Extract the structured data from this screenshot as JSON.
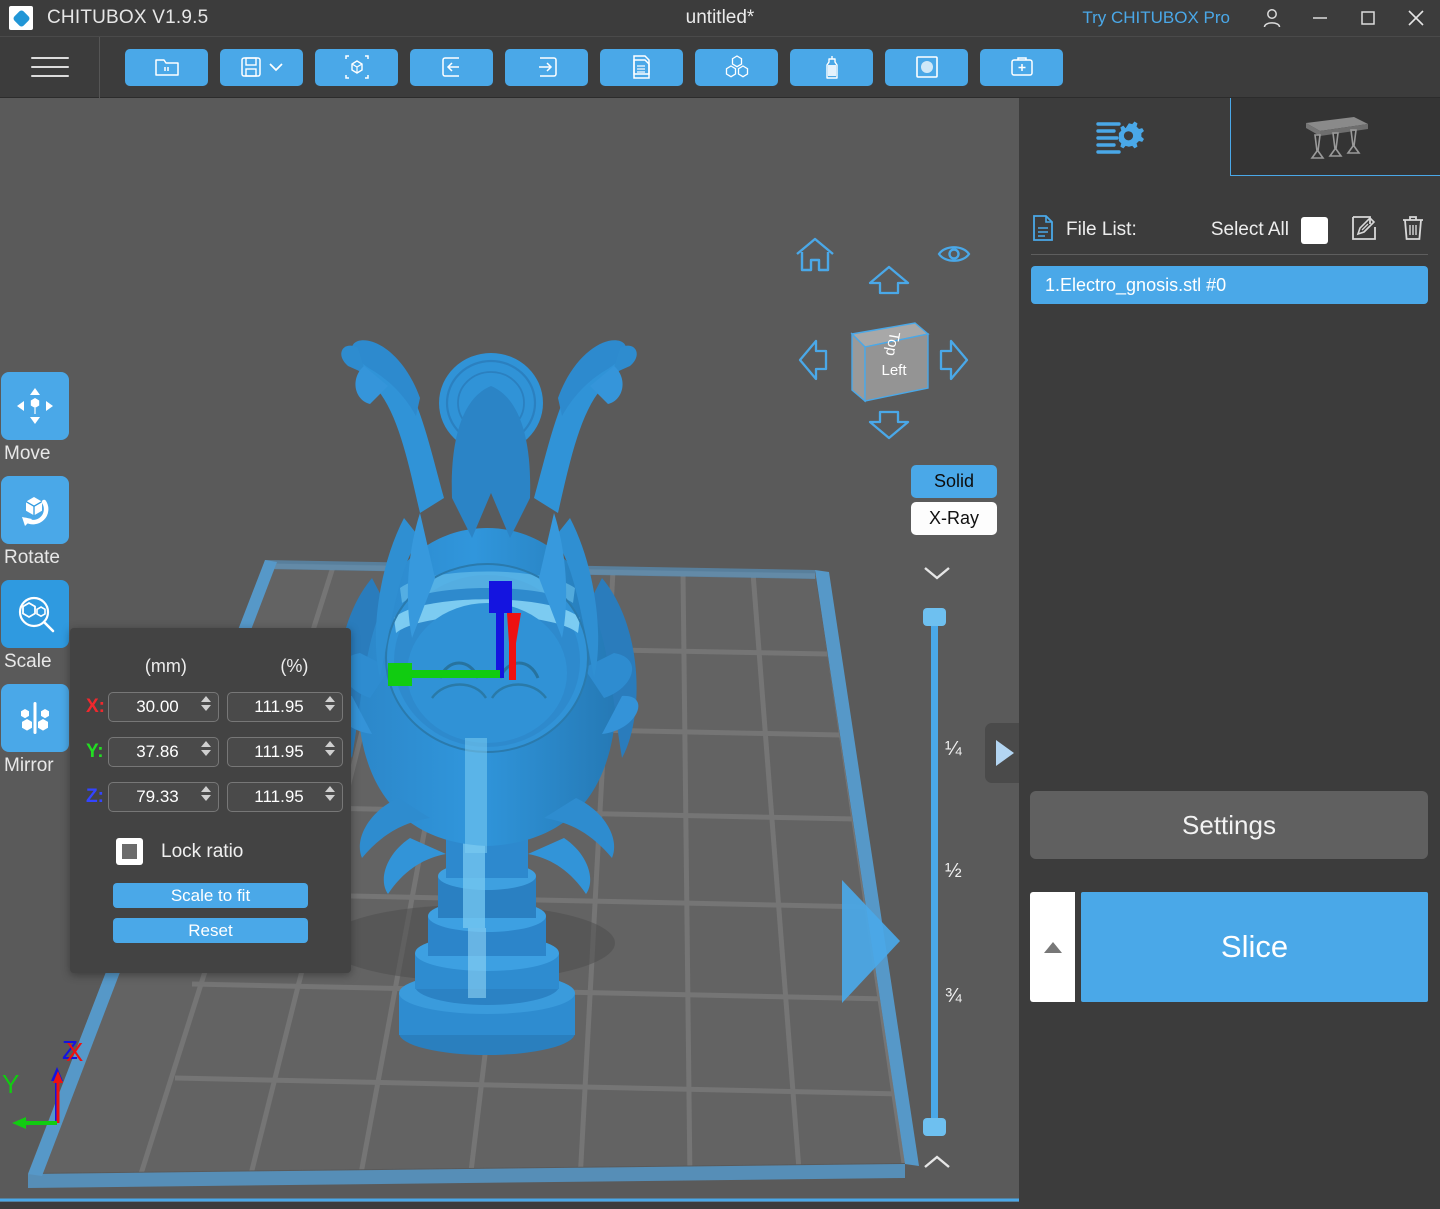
{
  "titlebar": {
    "app_name": "CHITUBOX V1.9.5",
    "document_title": "untitled*",
    "try_pro": "Try CHITUBOX Pro",
    "account_icon": "user-account-icon",
    "minimize_icon": "minimize-icon",
    "maximize_icon": "maximize-icon",
    "close_icon": "close-icon",
    "logo_icon": "chitubox-logo-icon"
  },
  "toolbar": {
    "menu_icon": "hamburger-menu-icon",
    "buttons": [
      {
        "name": "open-file",
        "icon": "folder-open-icon"
      },
      {
        "name": "save-file",
        "icon": "floppy-save-icon",
        "has_dropdown": true
      },
      {
        "name": "add-model",
        "icon": "add-model-box-icon"
      },
      {
        "name": "import",
        "icon": "arrow-into-box-icon"
      },
      {
        "name": "export",
        "icon": "arrow-out-of-box-icon"
      },
      {
        "name": "duplicate",
        "icon": "copy-pages-icon"
      },
      {
        "name": "arrange-all",
        "icon": "three-cubes-icon"
      },
      {
        "name": "hollow",
        "icon": "bottle-hollow-icon"
      },
      {
        "name": "dig-hole",
        "icon": "hole-square-icon"
      },
      {
        "name": "repair-model",
        "icon": "first-aid-kit-icon"
      }
    ]
  },
  "left_tools": [
    {
      "label": "Move",
      "icon": "move-arrows-cube-icon",
      "active": false
    },
    {
      "label": "Rotate",
      "icon": "rotate-cube-icon",
      "active": false
    },
    {
      "label": "Scale",
      "icon": "scale-magnifier-icon",
      "active": true
    },
    {
      "label": "Mirror",
      "icon": "mirror-cubes-icon",
      "active": false
    }
  ],
  "scale_panel": {
    "header_mm": "(mm)",
    "header_pct": "(%)",
    "rows": [
      {
        "axis": "X:",
        "mm": "30.00",
        "pct": "111.95"
      },
      {
        "axis": "Y:",
        "mm": "37.86",
        "pct": "111.95"
      },
      {
        "axis": "Z:",
        "mm": "79.33",
        "pct": "111.95"
      }
    ],
    "lock_ratio_label": "Lock ratio",
    "lock_ratio_checked": false,
    "scale_to_fit_label": "Scale to fit",
    "reset_label": "Reset"
  },
  "viewport": {
    "gizmo": {
      "home_icon": "home-view-icon",
      "eye_icon": "eye-visibility-icon",
      "up_icon": "arrow-up-icon",
      "down_icon": "arrow-down-icon",
      "left_icon": "arrow-left-icon",
      "right_icon": "arrow-right-icon",
      "cube_top_face": "Top",
      "cube_front_face": "Left"
    },
    "view_mode": {
      "solid_label": "Solid",
      "xray_label": "X-Ray",
      "selected": "Solid"
    },
    "slider": {
      "chevron_down_icon": "chevron-down-icon",
      "chevron_up_icon": "chevron-up-icon",
      "ticks": [
        "¼",
        "½",
        "¾"
      ]
    },
    "panel_toggle_icon": "play-triangle-right-icon",
    "axis_indicator": {
      "x": "X",
      "y": "Y",
      "z": "Z"
    }
  },
  "right_panel": {
    "tabs": [
      {
        "name": "tab-settings-gear",
        "icon": "sliders-gear-icon",
        "active": true
      },
      {
        "name": "tab-supports",
        "icon": "supports-platform-icon",
        "active": false
      }
    ],
    "file_list": {
      "icon": "file-document-icon",
      "label": "File List:",
      "select_all_label": "Select All",
      "select_all_checked": false,
      "edit_icon": "rename-pencil-icon",
      "delete_icon": "trash-delete-icon",
      "items": [
        {
          "name": "1.Electro_gnosis.stl #0",
          "selected": true
        }
      ]
    },
    "settings_label": "Settings",
    "slice_label": "Slice",
    "slice_expand_icon": "triangle-up-icon"
  },
  "colors": {
    "accent_blue": "#4aa8e8",
    "panel_bg": "#3c3c3c",
    "viewport_bg": "#5a5a5a",
    "model_blue": "#2e8fd0",
    "axis_x": "#f0282d",
    "axis_y": "#22dd22",
    "axis_z": "#3344ff"
  }
}
